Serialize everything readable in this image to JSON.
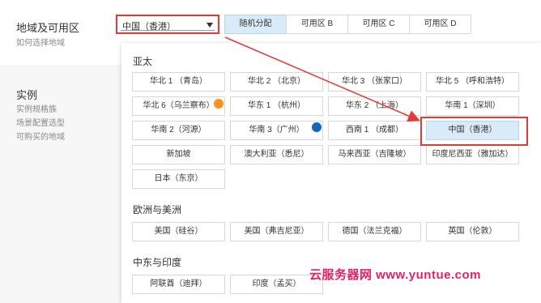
{
  "region": {
    "title": "地域及可用区",
    "help": "如何选择地域",
    "selected_value": "中国（香港）"
  },
  "zone_tabs": [
    "随机分配",
    "可用区 B",
    "可用区 C",
    "可用区 D"
  ],
  "instance": {
    "title": "实例",
    "links": [
      "实例规格族",
      "场景配置选型",
      "可购买的地域"
    ]
  },
  "groups": {
    "asia": {
      "title": "亚太",
      "options": [
        "华北 1 （青岛）",
        "华北 2 （北京）",
        "华北 3 （张家口）",
        "华北 5 （呼和浩特）",
        "华北 6（乌兰察布）",
        "华东 1 （杭州）",
        "华东 2 （上海）",
        "华南 1（深圳）",
        "华南 2（河源）",
        "华南 3（广州）",
        "西南 1 （成都）",
        "中国（香港）",
        "新加坡",
        "澳大利亚（悉尼）",
        "马来西亚（吉隆坡）",
        "印度尼西亚（雅加达）",
        "日本（东京）"
      ]
    },
    "europe": {
      "title": "欧洲与美洲",
      "options": [
        "美国（硅谷）",
        "美国（弗吉尼亚）",
        "德国（法兰克福）",
        "英国（伦敦）"
      ]
    },
    "mideast": {
      "title": "中东与印度",
      "options": [
        "阿联酋（迪拜）",
        "印度（孟买）"
      ]
    }
  },
  "watermark": "云服务器网 www.yuntue.com",
  "colors": {
    "accent_red": "#e53935",
    "selected_bg": "#d9ebf8",
    "dot_orange": "#f7931e",
    "dot_blue": "#1565c0",
    "watermark": "#e91e63"
  }
}
